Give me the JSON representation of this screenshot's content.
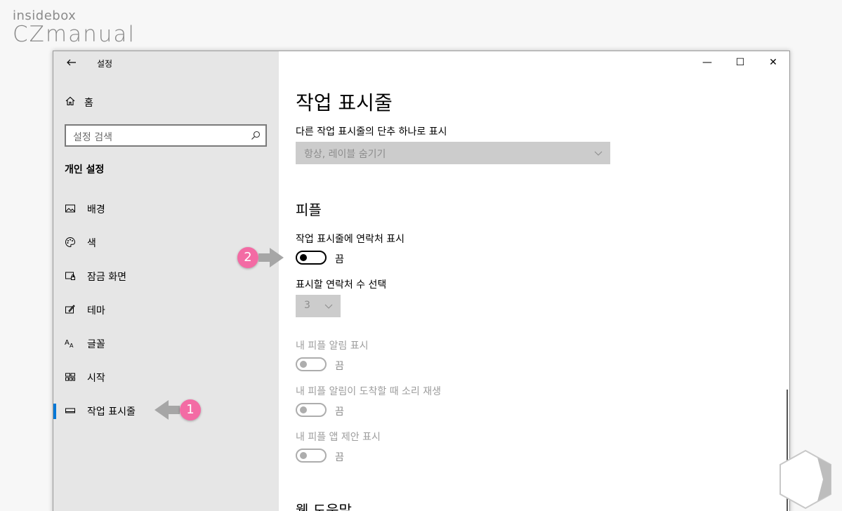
{
  "logo": {
    "small": "insidebox",
    "big": "CZmanual"
  },
  "window": {
    "app_title": "설정",
    "controls": {
      "minimize": "—",
      "maximize": "☐",
      "close": "✕"
    }
  },
  "sidebar": {
    "home_label": "홈",
    "search_placeholder": "설정 검색",
    "section_title": "개인 설정",
    "items": [
      {
        "label": "배경",
        "icon": "image-icon"
      },
      {
        "label": "색",
        "icon": "palette-icon"
      },
      {
        "label": "잠금 화면",
        "icon": "lock-screen-icon"
      },
      {
        "label": "테마",
        "icon": "theme-icon"
      },
      {
        "label": "글꼴",
        "icon": "font-icon"
      },
      {
        "label": "시작",
        "icon": "start-icon"
      },
      {
        "label": "작업 표시줄",
        "icon": "taskbar-icon",
        "active": true
      }
    ]
  },
  "main": {
    "title": "작업 표시줄",
    "combine_label": "다른 작업 표시줄의 단추 하나로 표시",
    "combine_value": "항상, 레이블 숨기기",
    "people_heading": "피플",
    "show_contacts_label": "작업 표시줄에 연락처 표시",
    "show_contacts_state": "끔",
    "contact_count_label": "표시할 연락처 수 선택",
    "contact_count_value": "3",
    "notif_label": "내 피플 알림 표시",
    "notif_state": "끔",
    "sound_label": "내 피플 알림이 도착할 때 소리 재생",
    "sound_state": "끔",
    "suggest_label": "내 피플 앱 제안 표시",
    "suggest_state": "끔",
    "next_heading": "웹 도움말"
  },
  "annotations": {
    "marker1": "1",
    "marker2": "2"
  },
  "colors": {
    "accent": "#0078d7",
    "marker": "#f36ba4",
    "sidebar_bg": "#e6e6e6"
  }
}
